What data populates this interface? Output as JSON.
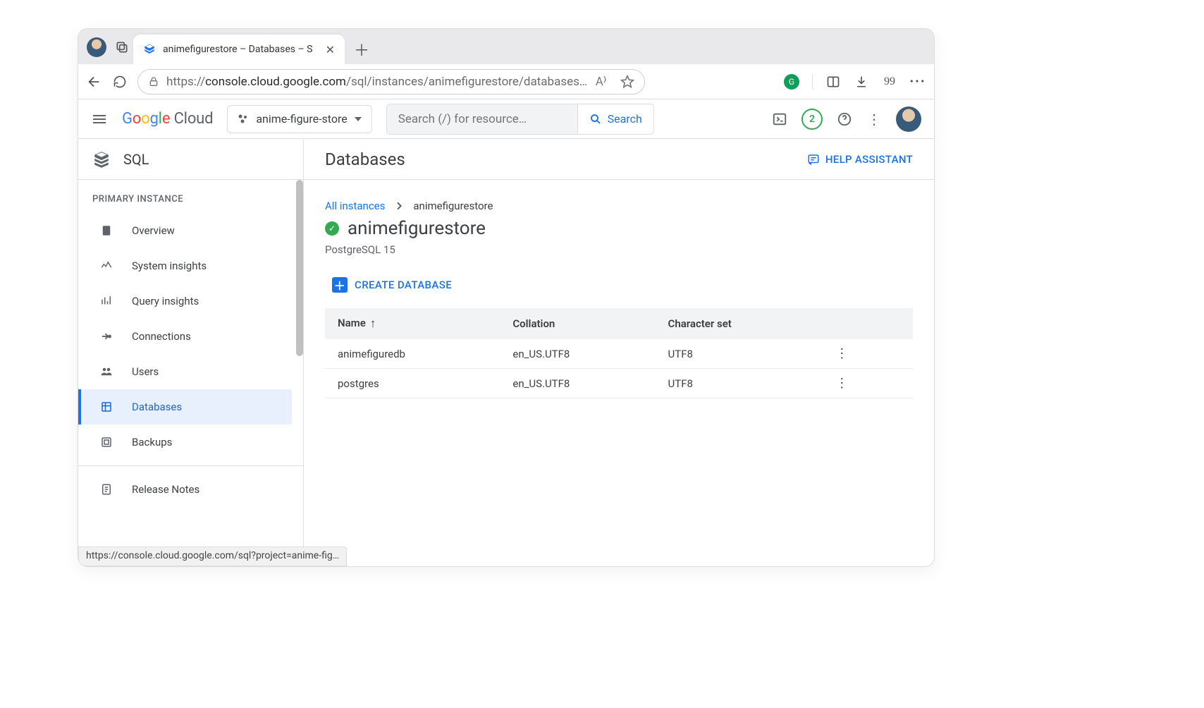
{
  "browser": {
    "tab_title": "animefigurestore – Databases – S",
    "url_host": "console.cloud.google.com",
    "url_path": "/sql/instances/animefigurestore/databases?pr…",
    "status_bar": "https://console.cloud.google.com/sql?project=anime-fig…",
    "toolbar_quote": "99"
  },
  "header": {
    "logo_google": "Google",
    "logo_cloud": "Cloud",
    "project": "anime-figure-store",
    "search_placeholder": "Search (/) for resource…",
    "search_button": "Search",
    "notif_count": "2"
  },
  "sidebar": {
    "product": "SQL",
    "section": "PRIMARY INSTANCE",
    "items": [
      {
        "label": "Overview"
      },
      {
        "label": "System insights"
      },
      {
        "label": "Query insights"
      },
      {
        "label": "Connections"
      },
      {
        "label": "Users"
      },
      {
        "label": "Databases"
      },
      {
        "label": "Backups"
      }
    ],
    "release_notes": "Release Notes"
  },
  "main": {
    "title": "Databases",
    "assist": "HELP ASSISTANT",
    "breadcrumb_root": "All instances",
    "breadcrumb_leaf": "animefigurestore",
    "instance": "animefigurestore",
    "engine": "PostgreSQL 15",
    "create_db": "CREATE DATABASE",
    "cols": {
      "name": "Name",
      "collation": "Collation",
      "charset": "Character set"
    },
    "rows": [
      {
        "name": "animefiguredb",
        "collation": "en_US.UTF8",
        "charset": "UTF8"
      },
      {
        "name": "postgres",
        "collation": "en_US.UTF8",
        "charset": "UTF8"
      }
    ]
  }
}
